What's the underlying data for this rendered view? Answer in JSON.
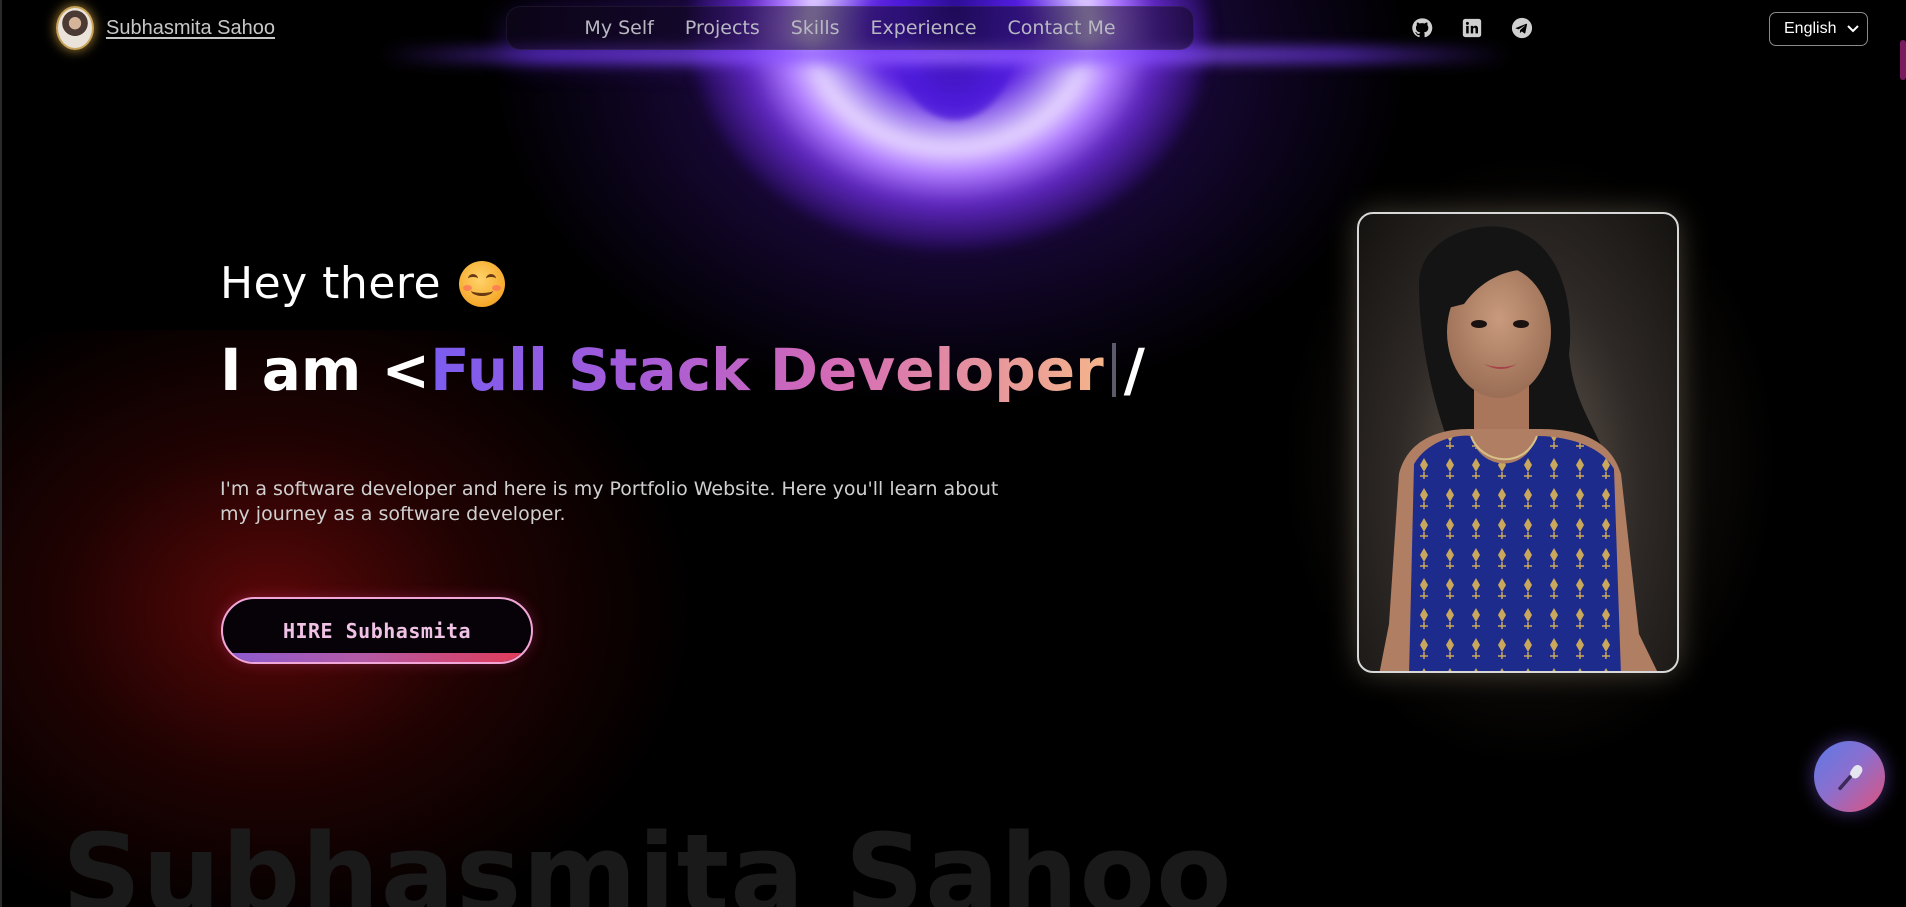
{
  "header": {
    "brand_name": "Subhasmita Sahoo",
    "nav": [
      {
        "label": "My Self"
      },
      {
        "label": "Projects"
      },
      {
        "label": "Skills"
      },
      {
        "label": "Experience"
      },
      {
        "label": "Contact Me"
      }
    ],
    "socials": [
      {
        "icon": "github-icon"
      },
      {
        "icon": "linkedin-icon"
      },
      {
        "icon": "telegram-icon"
      }
    ],
    "language": {
      "selected": "English"
    }
  },
  "hero": {
    "greeting": "Hey there",
    "greeting_emoji": "smiling-face-emoji",
    "role_prefix": "I am <",
    "role_title": "Full Stack Developer",
    "role_suffix": "/",
    "intro": "I'm a software developer and here is my Portfolio Website. Here you'll learn about my journey as a software developer.",
    "hire_label": "HIRE Subhasmita"
  },
  "background_name": "Subhasmita Sahoo",
  "colors": {
    "accent_purple": "#7b5cf0",
    "accent_pink": "#d56bb6",
    "accent_peach": "#f4b48a",
    "button_border": "#f1a6d8",
    "button_bar_end": "#e23a55"
  }
}
